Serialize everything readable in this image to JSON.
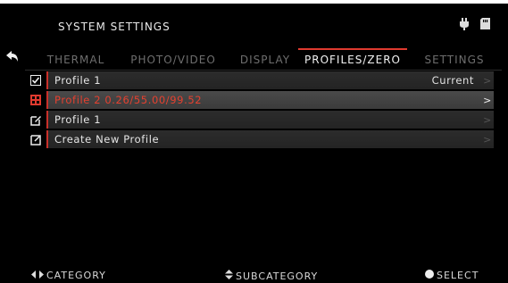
{
  "header": {
    "title": "SYSTEM SETTINGS",
    "status_icons": [
      "plug-icon",
      "sd-card-icon"
    ]
  },
  "tabs": [
    {
      "label": "THERMAL",
      "active": false
    },
    {
      "label": "PHOTO/VIDEO",
      "active": false
    },
    {
      "label": "DISPLAY",
      "active": false
    },
    {
      "label": "PROFILES/ZERO",
      "active": true
    },
    {
      "label": "SETTINGS",
      "active": false
    }
  ],
  "profiles": [
    {
      "icon": "checkbox-checked-icon",
      "label": "Profile 1",
      "value": "Current",
      "selected": false
    },
    {
      "icon": "grid-icon",
      "label": "Profile 2 0.26/55.00/99.52",
      "value": "",
      "selected": true
    },
    {
      "icon": "edit-icon",
      "label": "Profile 1",
      "value": "",
      "selected": false
    },
    {
      "icon": "new-profile-icon",
      "label": "Create New Profile",
      "value": "",
      "selected": false
    }
  ],
  "footer": {
    "category": "CATEGORY",
    "subcategory": "SUBCATEGORY",
    "select": "SELECT"
  },
  "colors": {
    "accent": "#e03a2f",
    "background": "#000000",
    "row": "#262626",
    "row_selected": "#3f3f3f"
  }
}
